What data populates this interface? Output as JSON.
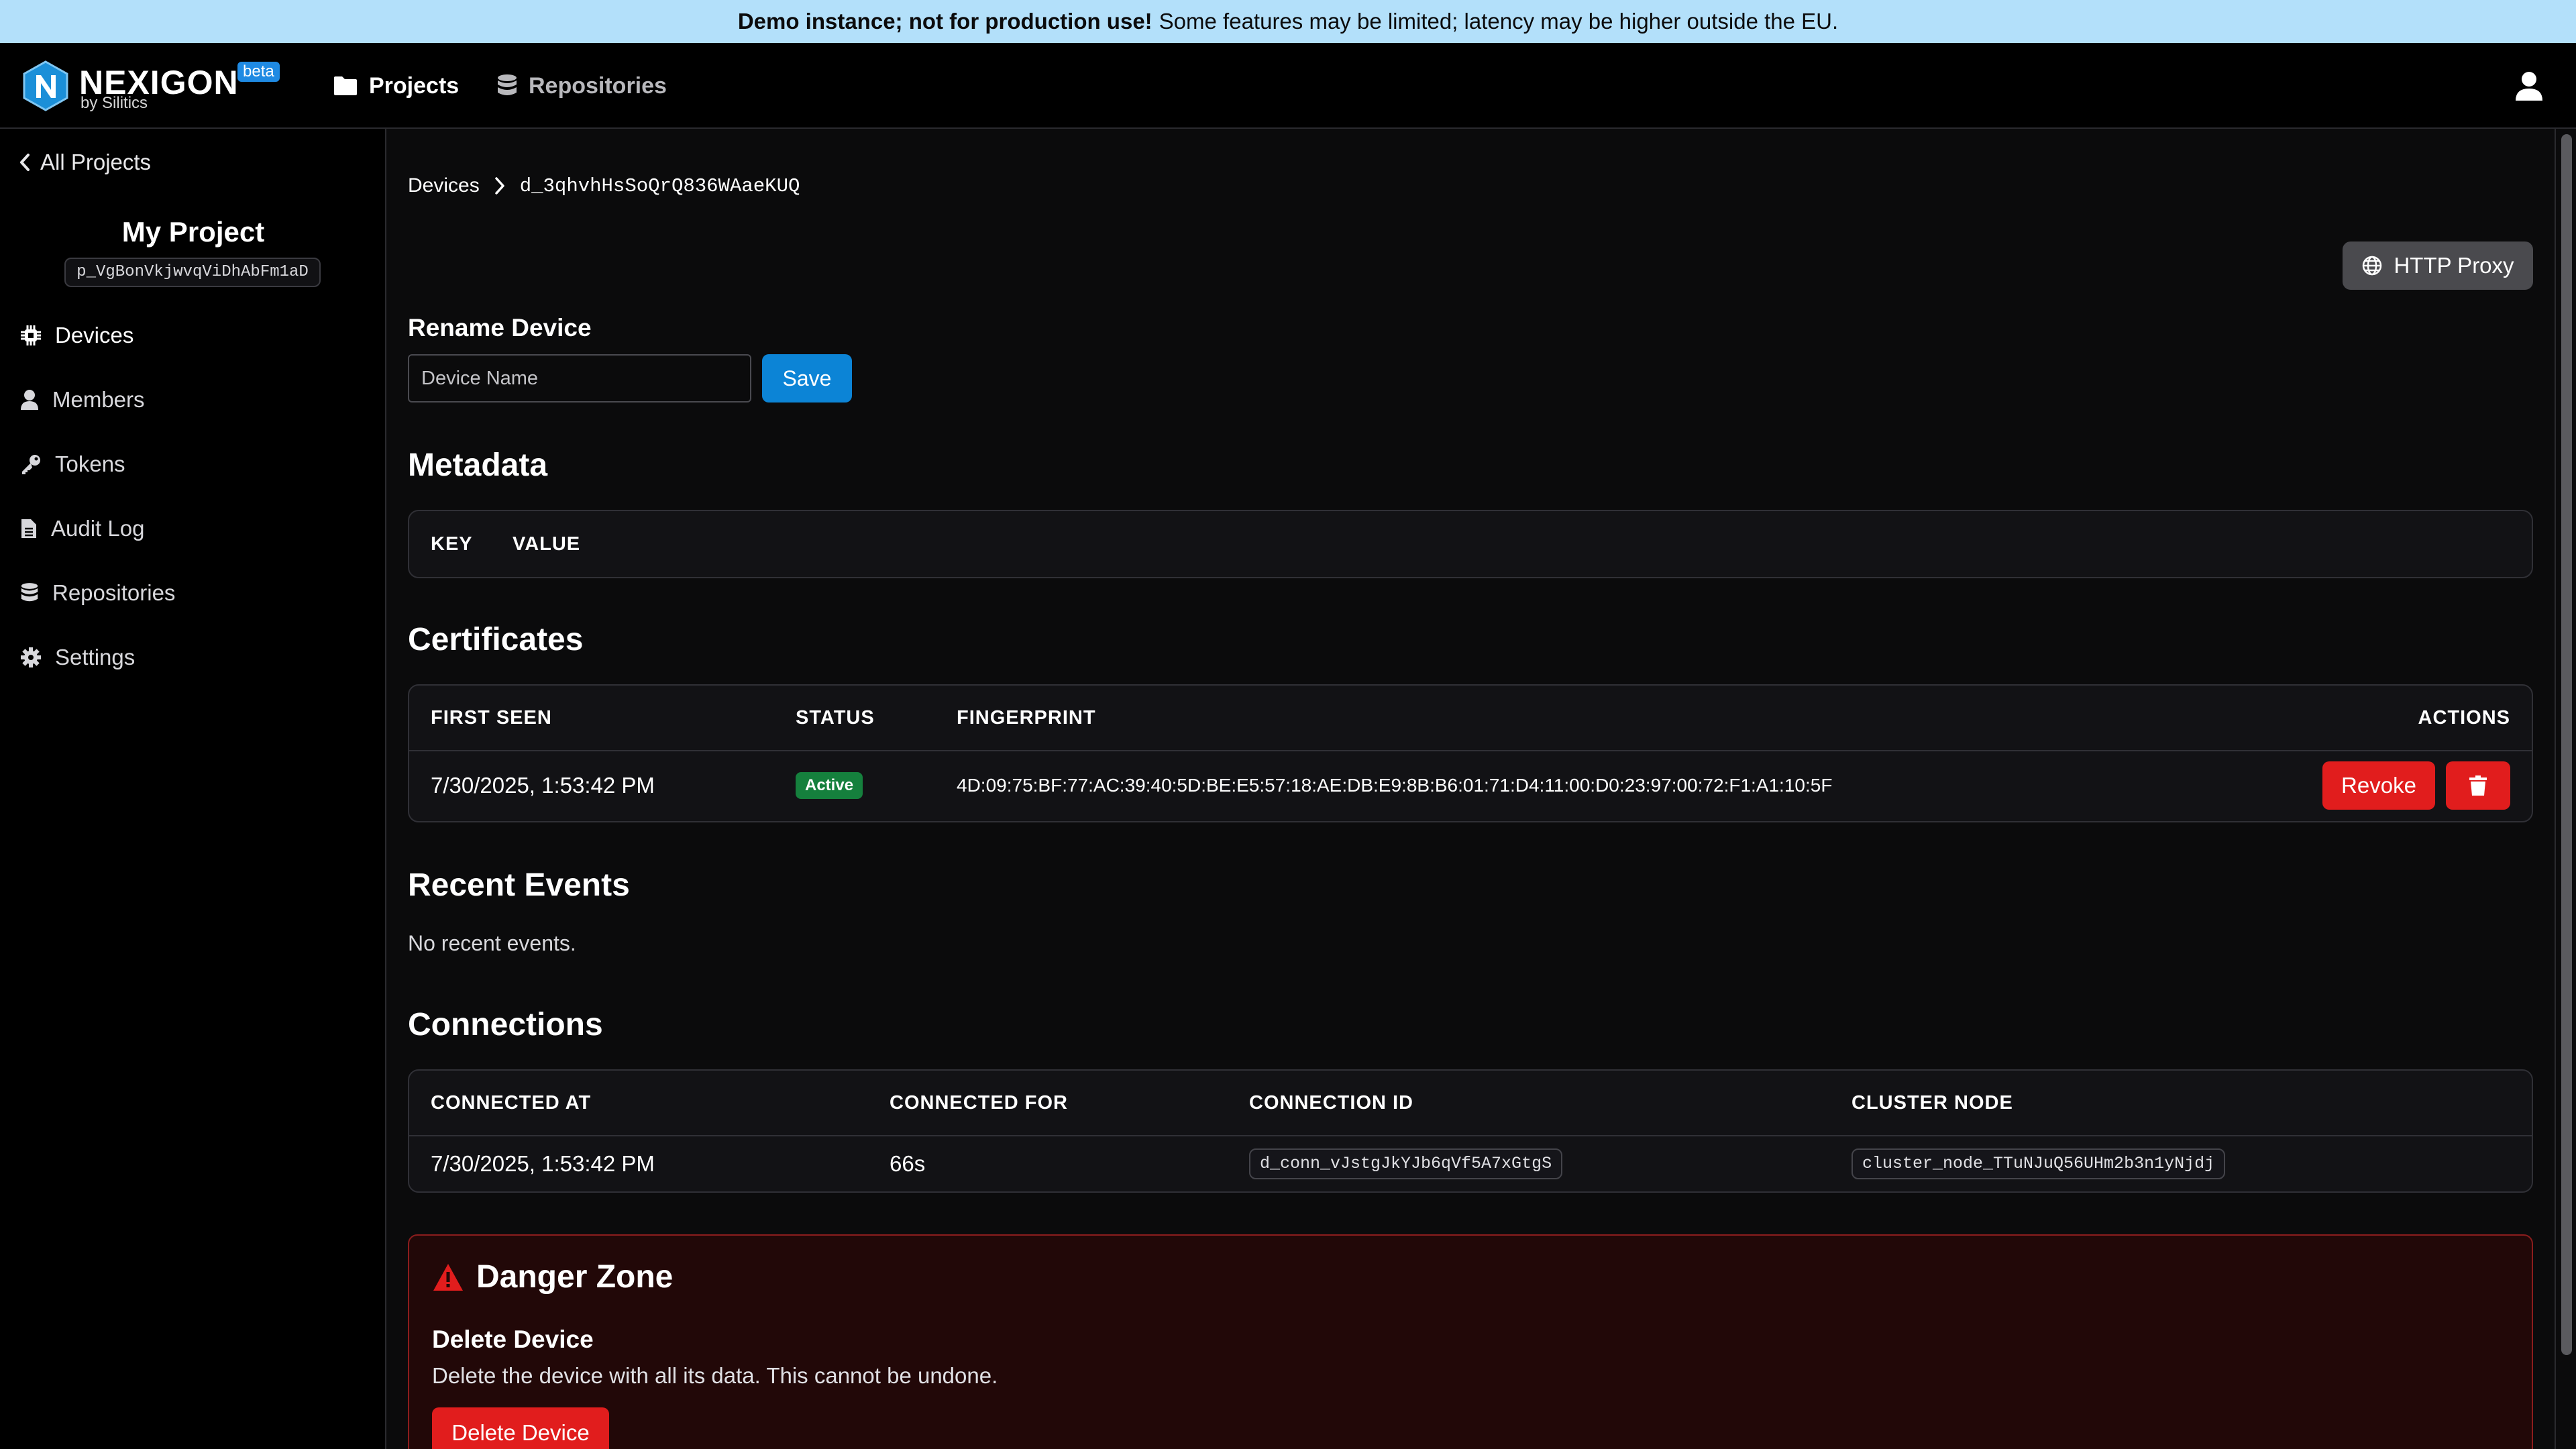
{
  "banner": {
    "bold": "Demo instance; not for production use!",
    "text": "Some features may be limited; latency may be higher outside the EU."
  },
  "brand": {
    "name": "NEXIGON",
    "by": "by Silitics",
    "badge": "beta"
  },
  "nav": {
    "projects": "Projects",
    "repositories": "Repositories"
  },
  "sidebar": {
    "back": "All Projects",
    "project_name": "My Project",
    "project_id": "p_VgBonVkjwvqViDhAbFm1aD",
    "items": [
      {
        "label": "Devices",
        "icon": "chip-icon"
      },
      {
        "label": "Members",
        "icon": "user-icon"
      },
      {
        "label": "Tokens",
        "icon": "key-icon"
      },
      {
        "label": "Audit Log",
        "icon": "document-icon"
      },
      {
        "label": "Repositories",
        "icon": "database-icon"
      },
      {
        "label": "Settings",
        "icon": "gear-icon"
      }
    ]
  },
  "breadcrumb": {
    "root": "Devices",
    "device_id": "d_3qhvhHsSoQrQ836WAaeKUQ"
  },
  "proxy_button": "HTTP Proxy",
  "rename": {
    "title": "Rename Device",
    "placeholder": "Device Name",
    "save": "Save"
  },
  "metadata": {
    "title": "Metadata",
    "headers": [
      "KEY",
      "VALUE"
    ]
  },
  "certificates": {
    "title": "Certificates",
    "headers": {
      "first_seen": "FIRST SEEN",
      "status": "STATUS",
      "fingerprint": "FINGERPRINT",
      "actions": "ACTIONS"
    },
    "rows": [
      {
        "first_seen": "7/30/2025, 1:53:42 PM",
        "status": "Active",
        "fingerprint": "4D:09:75:BF:77:AC:39:40:5D:BE:E5:57:18:AE:DB:E9:8B:B6:01:71:D4:11:00:D0:23:97:00:72:F1:A1:10:5F",
        "revoke": "Revoke"
      }
    ]
  },
  "events": {
    "title": "Recent Events",
    "empty": "No recent events."
  },
  "connections": {
    "title": "Connections",
    "headers": {
      "connected_at": "CONNECTED AT",
      "connected_for": "CONNECTED FOR",
      "connection_id": "CONNECTION ID",
      "cluster_node": "CLUSTER NODE"
    },
    "rows": [
      {
        "connected_at": "7/30/2025, 1:53:42 PM",
        "connected_for": "66s",
        "connection_id": "d_conn_vJstgJkYJb6qVf5A7xGtgS",
        "cluster_node": "cluster_node_TTuNJuQ56UHm2b3n1yNjdj"
      }
    ]
  },
  "danger": {
    "title": "Danger Zone",
    "subtitle": "Delete Device",
    "description": "Delete the device with all its data. This cannot be undone.",
    "button": "Delete Device"
  },
  "colors": {
    "accent": "#0c84d6",
    "danger": "#e11d1d",
    "success": "#15803d",
    "banner": "#b3e0fa"
  }
}
